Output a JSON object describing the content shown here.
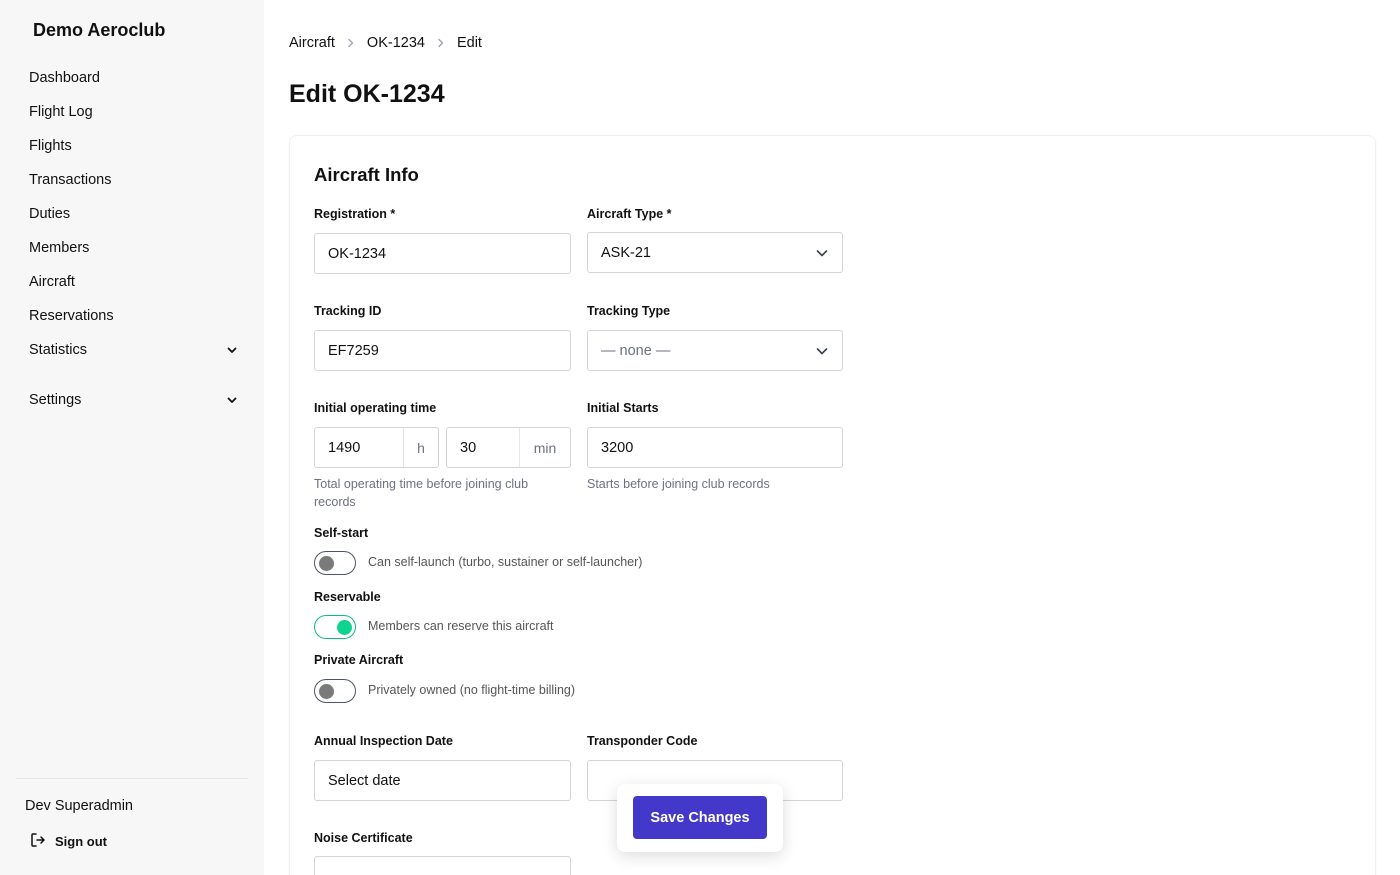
{
  "app": {
    "title": "Demo Aeroclub"
  },
  "sidebar": {
    "items": [
      {
        "label": "Dashboard"
      },
      {
        "label": "Flight Log"
      },
      {
        "label": "Flights"
      },
      {
        "label": "Transactions"
      },
      {
        "label": "Duties"
      },
      {
        "label": "Members"
      },
      {
        "label": "Aircraft"
      },
      {
        "label": "Reservations"
      },
      {
        "label": "Statistics",
        "icon": "chevron-down-icon"
      },
      {
        "label": "Settings",
        "icon": "chevron-down-icon"
      }
    ],
    "user": {
      "name": "Dev Superadmin"
    },
    "signout_label": "Sign out"
  },
  "breadcrumb": [
    "Aircraft",
    "OK-1234",
    "Edit"
  ],
  "page": {
    "title": "Edit OK-1234"
  },
  "form": {
    "section_title": "Aircraft Info",
    "registration": {
      "label": "Registration *",
      "value": "OK-1234"
    },
    "aircraft_type": {
      "label": "Aircraft Type *",
      "value": "ASK-21"
    },
    "tracking_id": {
      "label": "Tracking ID",
      "value": "EF7259"
    },
    "tracking_type": {
      "label": "Tracking Type",
      "value": "— none —"
    },
    "initial_operating_time": {
      "label": "Initial operating time",
      "hours": "1490",
      "hours_unit": "h",
      "minutes": "30",
      "minutes_unit": "min",
      "help": "Total operating time before joining club records"
    },
    "initial_starts": {
      "label": "Initial Starts",
      "value": "3200",
      "help": "Starts before joining club records"
    },
    "self_start": {
      "label": "Self-start",
      "text": "Can self-launch (turbo, sustainer or self-launcher)",
      "checked": false
    },
    "reservable": {
      "label": "Reservable",
      "text": "Members can reserve this aircraft",
      "checked": true
    },
    "private_aircraft": {
      "label": "Private Aircraft",
      "text": "Privately owned (no flight-time billing)",
      "checked": false
    },
    "annual_inspection_date": {
      "label": "Annual Inspection Date",
      "value": "Select date"
    },
    "transponder_code": {
      "label": "Transponder Code",
      "value": ""
    },
    "noise_certificate": {
      "label": "Noise Certificate",
      "value": ""
    }
  },
  "actions": {
    "save_label": "Save Changes"
  },
  "colors": {
    "accent": "#4338ca",
    "toggle_on": "#10d48e",
    "sidebar_bg": "#f7f7f7"
  }
}
